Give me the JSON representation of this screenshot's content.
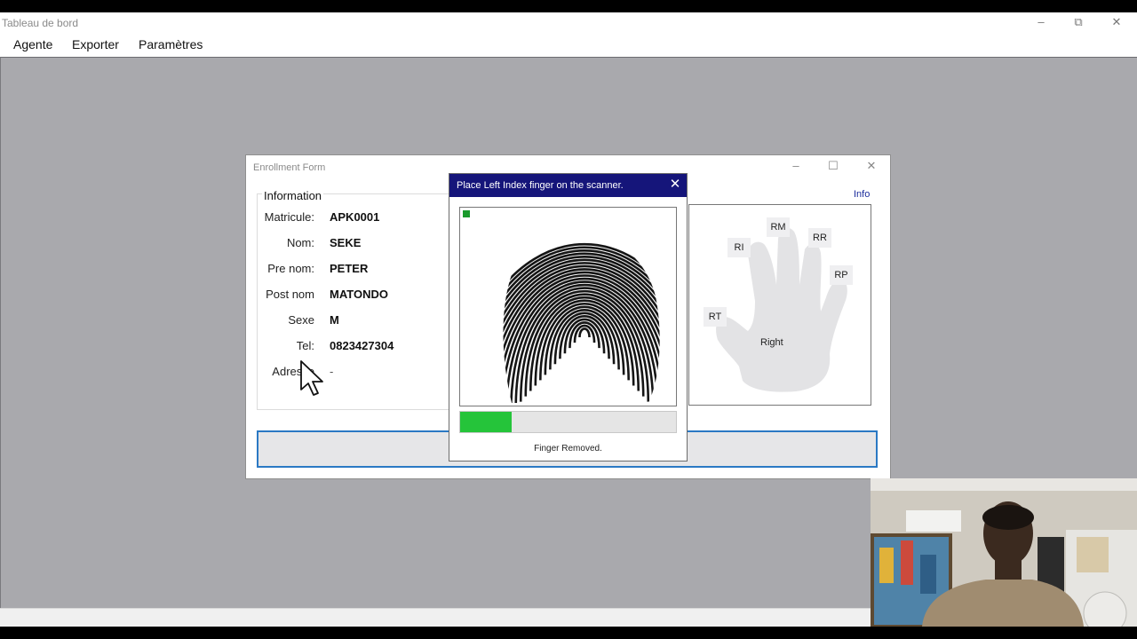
{
  "window": {
    "title": "Tableau de bord"
  },
  "menu": [
    {
      "label": "Agente"
    },
    {
      "label": "Exporter"
    },
    {
      "label": "Paramètres"
    }
  ],
  "enrollment": {
    "title": "Enrollment Form",
    "info_legend": "Information",
    "info_link": "Info",
    "fields": [
      {
        "label": "Matricule:",
        "value": "APK0001"
      },
      {
        "label": "Nom:",
        "value": "SEKE"
      },
      {
        "label": "Pre nom:",
        "value": "PETER"
      },
      {
        "label": "Post nom",
        "value": "MATONDO"
      },
      {
        "label": "Sexe",
        "value": "M"
      },
      {
        "label": "Tel:",
        "value": "0823427304"
      },
      {
        "label": "Adresse",
        "value": "-"
      }
    ],
    "hand": {
      "side_label": "Right",
      "fingers": [
        "RT",
        "RI",
        "RM",
        "RR",
        "RP"
      ]
    }
  },
  "capture": {
    "title": "Place Left Index finger on the scanner.",
    "status": "Finger Removed.",
    "progress_fraction": 0.24,
    "quality_color": "#1a9a2c",
    "progress_color": "#25c43a",
    "header_color": "#15157a"
  },
  "icons": [
    "minimize-icon",
    "maximize-icon",
    "restore-icon",
    "close-icon",
    "hand-outline-icon",
    "fingerprint-image",
    "mouse-pointer-icon",
    "webcam-feed"
  ]
}
